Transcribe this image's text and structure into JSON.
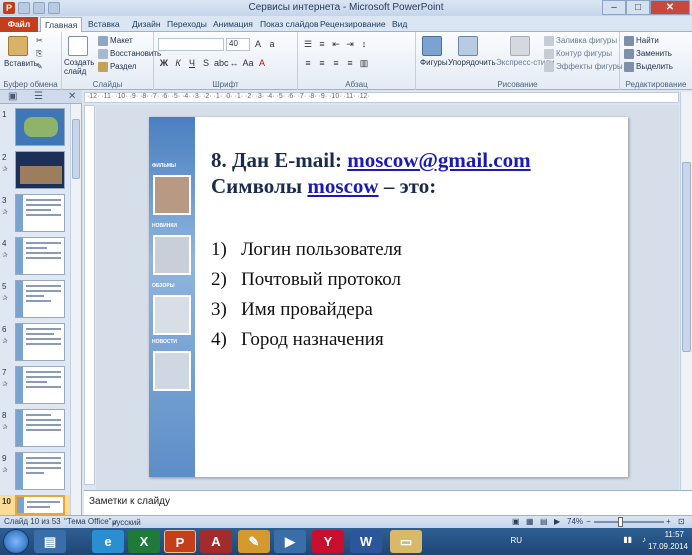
{
  "window": {
    "title": "Сервисы интернета - Microsoft PowerPoint",
    "app_icon": "P",
    "controls": {
      "minimize": "–",
      "maximize": "□",
      "close": "✕"
    }
  },
  "ribbon_tabs": [
    "Файл",
    "Главная",
    "Вставка",
    "Дизайн",
    "Переходы",
    "Анимация",
    "Показ слайдов",
    "Рецензирование",
    "Вид"
  ],
  "ribbon": {
    "clipboard": {
      "paste": "Вставить",
      "label": "Буфер обмена"
    },
    "slides": {
      "create": "Создать слайд",
      "layout": "Макет",
      "reset": "Восстановить",
      "section": "Раздел",
      "label": "Слайды"
    },
    "font": {
      "size": "40",
      "label": "Шрифт"
    },
    "paragraph": {
      "label": "Абзац"
    },
    "drawing": {
      "shapes": "Фигуры",
      "arrange": "Упорядочить",
      "quick_styles": "Экспресс-стили",
      "fill": "Заливка фигуры",
      "outline": "Контур фигуры",
      "effects": "Эффекты фигуры",
      "label": "Рисование"
    },
    "editing": {
      "find": "Найти",
      "replace": "Заменить",
      "select": "Выделить",
      "label": "Редактирование"
    }
  },
  "thumbnails": [
    "1",
    "2",
    "3",
    "4",
    "5",
    "6",
    "7",
    "8",
    "9",
    "10"
  ],
  "selected_slide": "10",
  "slide": {
    "title_prefix": "8. Дан E-mail: ",
    "title_email": "moscow@gmail.com",
    "line2_prefix": "Символы ",
    "line2_word": "moscow",
    "line2_suffix": " – это:",
    "options": [
      {
        "num": "1)",
        "text": "Логин пользователя"
      },
      {
        "num": "2)",
        "text": "Почтовый протокол"
      },
      {
        "num": "3)",
        "text": "Имя провайдера"
      },
      {
        "num": "4)",
        "text": "Город назначения"
      }
    ],
    "strip_tags": [
      "ФИЛЬМЫ",
      "НОВИНКИ",
      "ОБЗОРЫ",
      "НОВОСТИ"
    ]
  },
  "notes_placeholder": "Заметки к слайду",
  "status": {
    "slide": "Слайд 10 из 53",
    "theme": "\"Тема Office\"",
    "language": "русский",
    "zoom": "74%"
  },
  "taskbar": {
    "lang": "RU",
    "time": "11:57",
    "date": "17.09.2014"
  }
}
